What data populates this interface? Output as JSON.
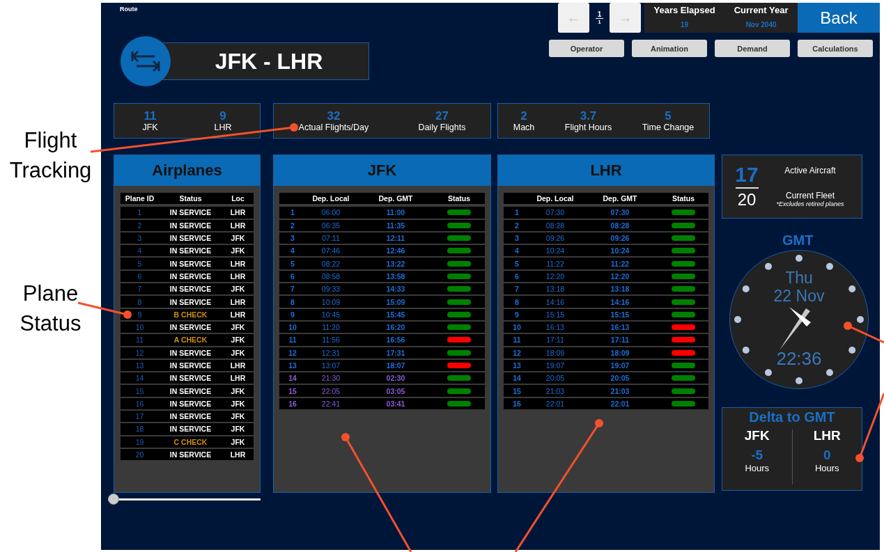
{
  "annotations": [
    {
      "text": "Flight Tracking"
    },
    {
      "text": "Plane Status"
    }
  ],
  "screen": {
    "section_label": "Route",
    "route": {
      "title": "JFK - LHR"
    },
    "pager": {
      "prev": "←",
      "current": "1",
      "total": "1",
      "next": "→"
    },
    "summary": [
      {
        "label": "Years Elapsed",
        "value": "19"
      },
      {
        "label": "Current Year",
        "value": "Nov 2040"
      }
    ],
    "back_button": "Back",
    "nav_buttons": [
      "Operator",
      "Animation",
      "Demand",
      "Calculations"
    ],
    "stat_groups": [
      [
        {
          "value": "11",
          "label": "JFK"
        },
        {
          "value": "9",
          "label": "LHR"
        }
      ],
      [
        {
          "value": "32",
          "label": "Actual Flights/Day"
        },
        {
          "value": "27",
          "label": "Daily Flights"
        }
      ],
      [
        {
          "value": "2",
          "label": "Mach"
        },
        {
          "value": "3.7",
          "label": "Flight Hours"
        },
        {
          "value": "5",
          "label": "Time Change"
        }
      ]
    ],
    "airplanes": {
      "title": "Airplanes",
      "columns": [
        "Plane ID",
        "Status",
        "Loc"
      ],
      "rows": [
        {
          "id": "1",
          "status": "IN SERVICE",
          "loc": "LHR",
          "color": "#ffffff"
        },
        {
          "id": "2",
          "status": "IN SERVICE",
          "loc": "LHR",
          "color": "#ffffff"
        },
        {
          "id": "3",
          "status": "IN SERVICE",
          "loc": "JFK",
          "color": "#ffffff"
        },
        {
          "id": "4",
          "status": "IN SERVICE",
          "loc": "JFK",
          "color": "#ffffff"
        },
        {
          "id": "5",
          "status": "IN SERVICE",
          "loc": "LHR",
          "color": "#ffffff"
        },
        {
          "id": "6",
          "status": "IN SERVICE",
          "loc": "LHR",
          "color": "#ffffff"
        },
        {
          "id": "7",
          "status": "IN SERVICE",
          "loc": "JFK",
          "color": "#ffffff"
        },
        {
          "id": "8",
          "status": "IN SERVICE",
          "loc": "LHR",
          "color": "#ffffff"
        },
        {
          "id": "9",
          "status": "B CHECK",
          "loc": "LHR",
          "color": "#d4900a"
        },
        {
          "id": "10",
          "status": "IN SERVICE",
          "loc": "JFK",
          "color": "#ffffff"
        },
        {
          "id": "11",
          "status": "A CHECK",
          "loc": "JFK",
          "color": "#d4900a"
        },
        {
          "id": "12",
          "status": "IN SERVICE",
          "loc": "JFK",
          "color": "#ffffff"
        },
        {
          "id": "13",
          "status": "IN SERVICE",
          "loc": "LHR",
          "color": "#ffffff"
        },
        {
          "id": "14",
          "status": "IN SERVICE",
          "loc": "LHR",
          "color": "#ffffff"
        },
        {
          "id": "15",
          "status": "IN SERVICE",
          "loc": "JFK",
          "color": "#ffffff"
        },
        {
          "id": "16",
          "status": "IN SERVICE",
          "loc": "JFK",
          "color": "#ffffff"
        },
        {
          "id": "17",
          "status": "IN SERVICE",
          "loc": "JFK",
          "color": "#ffffff"
        },
        {
          "id": "18",
          "status": "IN SERVICE",
          "loc": "JFK",
          "color": "#ffffff"
        },
        {
          "id": "19",
          "status": "C CHECK",
          "loc": "JFK",
          "color": "#d4900a"
        },
        {
          "id": "20",
          "status": "IN SERVICE",
          "loc": "LHR",
          "color": "#ffffff"
        }
      ]
    },
    "schedules": [
      {
        "title": "JFK",
        "columns": [
          "Dep. Local",
          "Dep. GMT",
          "Status"
        ],
        "rows": [
          {
            "no": "1",
            "local": "06:00",
            "gmt": "11:00",
            "next_day": false,
            "color": "#008000"
          },
          {
            "no": "2",
            "local": "06:35",
            "gmt": "11:35",
            "next_day": false,
            "color": "#008000"
          },
          {
            "no": "3",
            "local": "07:11",
            "gmt": "12:11",
            "next_day": false,
            "color": "#008000"
          },
          {
            "no": "4",
            "local": "07:46",
            "gmt": "12:46",
            "next_day": false,
            "color": "#008000"
          },
          {
            "no": "5",
            "local": "08:22",
            "gmt": "13:22",
            "next_day": false,
            "color": "#008000"
          },
          {
            "no": "6",
            "local": "08:58",
            "gmt": "13:58",
            "next_day": false,
            "color": "#008000"
          },
          {
            "no": "7",
            "local": "09:33",
            "gmt": "14:33",
            "next_day": false,
            "color": "#008000"
          },
          {
            "no": "8",
            "local": "10:09",
            "gmt": "15:09",
            "next_day": false,
            "color": "#008000"
          },
          {
            "no": "9",
            "local": "10:45",
            "gmt": "15:45",
            "next_day": false,
            "color": "#008000"
          },
          {
            "no": "10",
            "local": "11:20",
            "gmt": "16:20",
            "next_day": false,
            "color": "#008000"
          },
          {
            "no": "11",
            "local": "11:56",
            "gmt": "16:56",
            "next_day": false,
            "color": "#ff0000"
          },
          {
            "no": "12",
            "local": "12:31",
            "gmt": "17:31",
            "next_day": false,
            "color": "#008000"
          },
          {
            "no": "13",
            "local": "13:07",
            "gmt": "18:07",
            "next_day": false,
            "color": "#ff0000"
          },
          {
            "no": "14",
            "local": "21:30",
            "gmt": "02:30",
            "next_day": true,
            "color": "#008000"
          },
          {
            "no": "15",
            "local": "22:05",
            "gmt": "03:05",
            "next_day": true,
            "color": "#008000"
          },
          {
            "no": "16",
            "local": "22:41",
            "gmt": "03:41",
            "next_day": true,
            "color": "#008000"
          }
        ]
      },
      {
        "title": "LHR",
        "columns": [
          "Dep. Local",
          "Dep. GMT",
          "Status"
        ],
        "rows": [
          {
            "no": "1",
            "local": "07:30",
            "gmt": "07:30",
            "next_day": false,
            "color": "#008000"
          },
          {
            "no": "2",
            "local": "08:28",
            "gmt": "08:28",
            "next_day": false,
            "color": "#008000"
          },
          {
            "no": "3",
            "local": "09:26",
            "gmt": "09:26",
            "next_day": false,
            "color": "#008000"
          },
          {
            "no": "4",
            "local": "10:24",
            "gmt": "10:24",
            "next_day": false,
            "color": "#008000"
          },
          {
            "no": "5",
            "local": "11:22",
            "gmt": "11:22",
            "next_day": false,
            "color": "#008000"
          },
          {
            "no": "6",
            "local": "12:20",
            "gmt": "12:20",
            "next_day": false,
            "color": "#008000"
          },
          {
            "no": "7",
            "local": "13:18",
            "gmt": "13:18",
            "next_day": false,
            "color": "#008000"
          },
          {
            "no": "8",
            "local": "14:16",
            "gmt": "14:16",
            "next_day": false,
            "color": "#008000"
          },
          {
            "no": "9",
            "local": "15:15",
            "gmt": "15:15",
            "next_day": false,
            "color": "#008000"
          },
          {
            "no": "10",
            "local": "16:13",
            "gmt": "16:13",
            "next_day": false,
            "color": "#ff0000"
          },
          {
            "no": "11",
            "local": "17:11",
            "gmt": "17:11",
            "next_day": false,
            "color": "#ff0000"
          },
          {
            "no": "12",
            "local": "18:09",
            "gmt": "18:09",
            "next_day": false,
            "color": "#ff0000"
          },
          {
            "no": "13",
            "local": "19:07",
            "gmt": "19:07",
            "next_day": false,
            "color": "#008000"
          },
          {
            "no": "14",
            "local": "20:05",
            "gmt": "20:05",
            "next_day": false,
            "color": "#008000"
          },
          {
            "no": "15",
            "local": "21:03",
            "gmt": "21:03",
            "next_day": false,
            "color": "#008000"
          },
          {
            "no": "16",
            "local": "22:01",
            "gmt": "22:01",
            "next_day": false,
            "color": "#008000"
          }
        ]
      }
    ],
    "fleet": {
      "active": "17",
      "total": "20",
      "active_label": "Active Aircraft",
      "total_label": "Current Fleet",
      "note": "*Excludes retired planes"
    },
    "clock": {
      "title": "GMT",
      "day": "Thu",
      "date": "22 Nov",
      "time": "22:36"
    },
    "delta": {
      "title": "Delta to GMT",
      "items": [
        {
          "airport": "JFK",
          "value": "-5",
          "unit": "Hours"
        },
        {
          "airport": "LHR",
          "value": "0",
          "unit": "Hours"
        }
      ]
    },
    "slider": {
      "level": 0
    }
  }
}
